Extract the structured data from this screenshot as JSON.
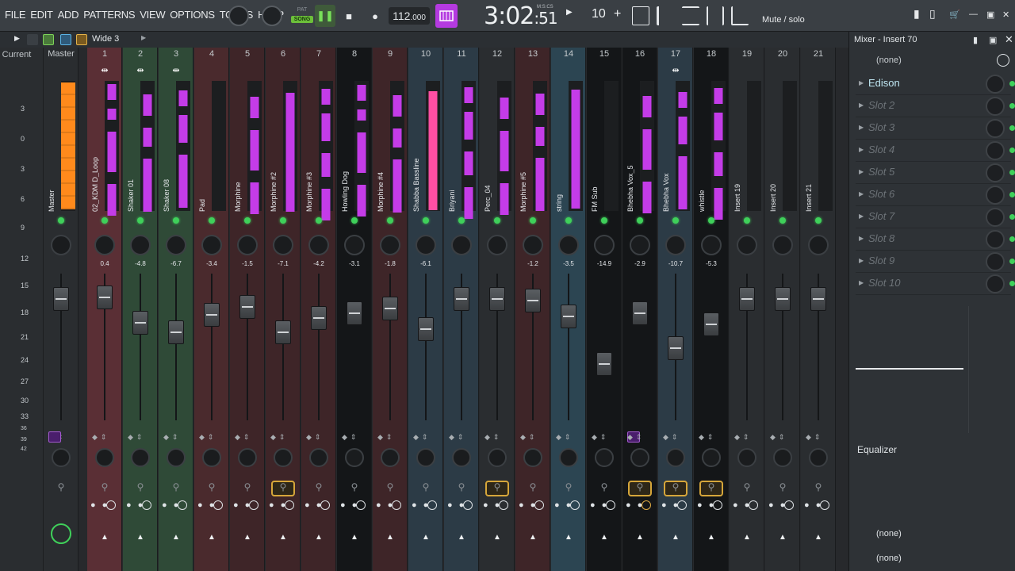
{
  "menu": [
    "FILE",
    "EDIT",
    "ADD",
    "PATTERNS",
    "VIEW",
    "OPTIONS",
    "TOOLS",
    "HELP"
  ],
  "transport": {
    "pat": "PAT",
    "song": "SONG",
    "tempo": "112",
    "tempo_dec": ".000",
    "time_main": "3:02",
    "time_sec": ":51",
    "time_format": "M:S:CS",
    "step": "10",
    "step_plus": "+"
  },
  "hint": "Mute / solo",
  "mixer_toolbar": {
    "preset": "Wide 3"
  },
  "scale_labels": [
    "Current",
    "Master"
  ],
  "db_ticks": [
    "3",
    "0",
    "3",
    "6",
    "9",
    "12",
    "15",
    "18",
    "21",
    "24",
    "27",
    "30",
    "33",
    "36",
    "39",
    "42"
  ],
  "master": {
    "name": "Master"
  },
  "channels": [
    {
      "num": "1",
      "name": "02_KDM D_Loop",
      "pan": "0.4",
      "bg": "#5a2f35",
      "route": true,
      "fader": 300,
      "stereo": false,
      "mic": false,
      "clk": false
    },
    {
      "num": "2",
      "name": "Shaker 01",
      "pan": "-4.8",
      "bg": "#2f4a37",
      "route": true,
      "fader": 332,
      "stereo": false,
      "mic": false,
      "clk": false
    },
    {
      "num": "3",
      "name": "Shaker 08",
      "pan": "-6.7",
      "bg": "#2f4a37",
      "route": true,
      "fader": 344,
      "stereo": false,
      "mic": false,
      "clk": false
    },
    {
      "num": "4",
      "name": "Pad",
      "pan": "-3.4",
      "bg": "#4a2a2d",
      "route": false,
      "fader": 322,
      "stereo": false,
      "mic": false,
      "clk": false
    },
    {
      "num": "5",
      "name": "Morphine",
      "pan": "-1.5",
      "bg": "#3e2528",
      "route": false,
      "fader": 312,
      "stereo": false,
      "mic": false,
      "clk": false
    },
    {
      "num": "6",
      "name": "Morphine #2",
      "pan": "-7.1",
      "bg": "#3e2528",
      "route": false,
      "fader": 344,
      "stereo": false,
      "mic": true,
      "clk": false
    },
    {
      "num": "7",
      "name": "Morphine #3",
      "pan": "-4.2",
      "bg": "#3e2528",
      "route": false,
      "fader": 326,
      "stereo": false,
      "mic": false,
      "clk": false
    },
    {
      "num": "8",
      "name": "Howling Dog",
      "pan": "-3.1",
      "bg": "#141618",
      "route": false,
      "fader": 320,
      "stereo": false,
      "mic": false,
      "clk": false
    },
    {
      "num": "9",
      "name": "Morphine #4",
      "pan": "-1.8",
      "bg": "#3e2528",
      "route": false,
      "fader": 314,
      "stereo": false,
      "mic": false,
      "clk": false
    },
    {
      "num": "10",
      "name": "Shabba Bassline",
      "pan": "-6.1",
      "bg": "#2c3b46",
      "route": false,
      "fader": 340,
      "stereo": false,
      "mic": false,
      "clk": false
    },
    {
      "num": "11",
      "name": "Briyani",
      "pan": "",
      "bg": "#2c3b46",
      "route": false,
      "fader": 302,
      "stereo": false,
      "mic": false,
      "clk": false
    },
    {
      "num": "12",
      "name": "Perc_04",
      "pan": "",
      "bg": "#2a2d30",
      "route": false,
      "fader": 302,
      "stereo": false,
      "mic": true,
      "clk": false
    },
    {
      "num": "13",
      "name": "Morphine #5",
      "pan": "-1.2",
      "bg": "#3e2528",
      "route": false,
      "fader": 304,
      "stereo": false,
      "mic": false,
      "clk": false
    },
    {
      "num": "14",
      "name": "string",
      "pan": "-3.5",
      "bg": "#2c4552",
      "route": false,
      "fader": 324,
      "stereo": false,
      "mic": false,
      "clk": false
    },
    {
      "num": "15",
      "name": "FM Sub",
      "pan": "-14.9",
      "bg": "#141618",
      "route": false,
      "fader": 384,
      "stereo": false,
      "mic": false,
      "clk": false
    },
    {
      "num": "16",
      "name": "Bhebha Vox_5",
      "pan": "-2.9",
      "bg": "#141618",
      "route": false,
      "fader": 320,
      "stereo": true,
      "mic": true,
      "clk": true
    },
    {
      "num": "17",
      "name": "Bhebha Vox",
      "pan": "-10.7",
      "bg": "#2c3b46",
      "route": true,
      "fader": 364,
      "stereo": false,
      "mic": true,
      "clk": false
    },
    {
      "num": "18",
      "name": "whistle",
      "pan": "-5.3",
      "bg": "#141618",
      "route": false,
      "fader": 334,
      "stereo": false,
      "mic": true,
      "clk": false
    },
    {
      "num": "19",
      "name": "Insert 19",
      "pan": "",
      "bg": "#2a2d30",
      "route": false,
      "fader": 302,
      "stereo": false,
      "mic": false,
      "clk": false
    },
    {
      "num": "20",
      "name": "Insert 20",
      "pan": "",
      "bg": "#2a2d30",
      "route": false,
      "fader": 302,
      "stereo": false,
      "mic": false,
      "clk": false
    },
    {
      "num": "21",
      "name": "Insert 21",
      "pan": "",
      "bg": "#2a2d30",
      "route": false,
      "fader": 302,
      "stereo": false,
      "mic": false,
      "clk": false
    }
  ],
  "panel": {
    "title": "Mixer - Insert 70",
    "input": "(none)",
    "slots": [
      "Edison",
      "Slot 2",
      "Slot 3",
      "Slot 4",
      "Slot 5",
      "Slot 6",
      "Slot 7",
      "Slot 8",
      "Slot 9",
      "Slot 10"
    ],
    "eq": "Equalizer",
    "out1": "(none)",
    "out2": "(none)"
  },
  "colors": {
    "accent_purple": "#b43ae0",
    "wave_magenta": "#c43ce8",
    "wave_pink": "#ff4fa3",
    "master_orange": "#ff8a1c",
    "led_green": "#3fd05a"
  }
}
